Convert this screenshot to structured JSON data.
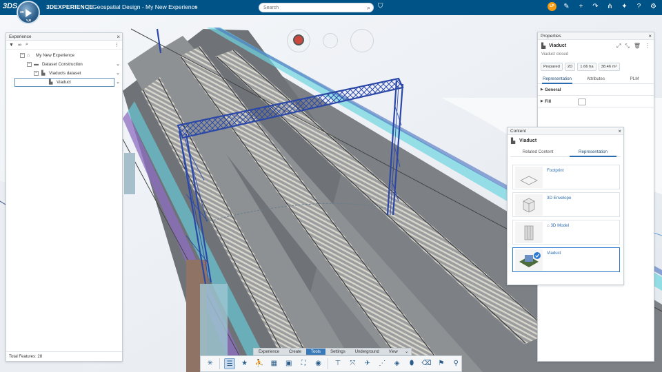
{
  "topbar": {
    "brand": "3DS",
    "compass_top": "3D",
    "compass_bottom": "V,R",
    "app_name": "3DEXPERIENCE",
    "app_separator": "|",
    "app_context": "Geospatial Design - My New Experience",
    "search_placeholder": "Search",
    "user_initials": "LP"
  },
  "experience_panel": {
    "title": "Experience",
    "tree": [
      {
        "label": "My New Experience",
        "level": 0
      },
      {
        "label": "Dataset Construction",
        "level": 1
      },
      {
        "label": "Viaducts dataset",
        "level": 2
      },
      {
        "label": "Viaduct",
        "level": 3,
        "selected": true
      }
    ],
    "footer": "Total Features: 28"
  },
  "properties_panel": {
    "title": "Properties",
    "object_name": "Viaduct",
    "object_status": "Viaduct closed",
    "chips": [
      "Prepared",
      "2D",
      "1.66 ha",
      "38.46 m²"
    ],
    "tabs": [
      "Representation",
      "Attributes",
      "PLM"
    ],
    "active_tab": "Representation",
    "sections": [
      "General",
      "Fill"
    ]
  },
  "content_panel": {
    "title": "Content",
    "object_name": "Viaduct",
    "tabs": [
      "Related Content",
      "Representation"
    ],
    "active_tab": "Representation",
    "cards": [
      {
        "label": "Footprint",
        "selected": false
      },
      {
        "label": "3D Envelope",
        "selected": false
      },
      {
        "label": "3D Model",
        "selected": false
      },
      {
        "label": "Viaduct",
        "selected": true
      }
    ]
  },
  "action_bar": {
    "tabs": [
      "Experience",
      "Create",
      "Tools",
      "Settings",
      "Underground",
      "View"
    ],
    "active_tab": "Tools"
  },
  "colors": {
    "topbar": "#005386",
    "gantry": "#2b48a8",
    "selection": "#2b7bd1"
  }
}
